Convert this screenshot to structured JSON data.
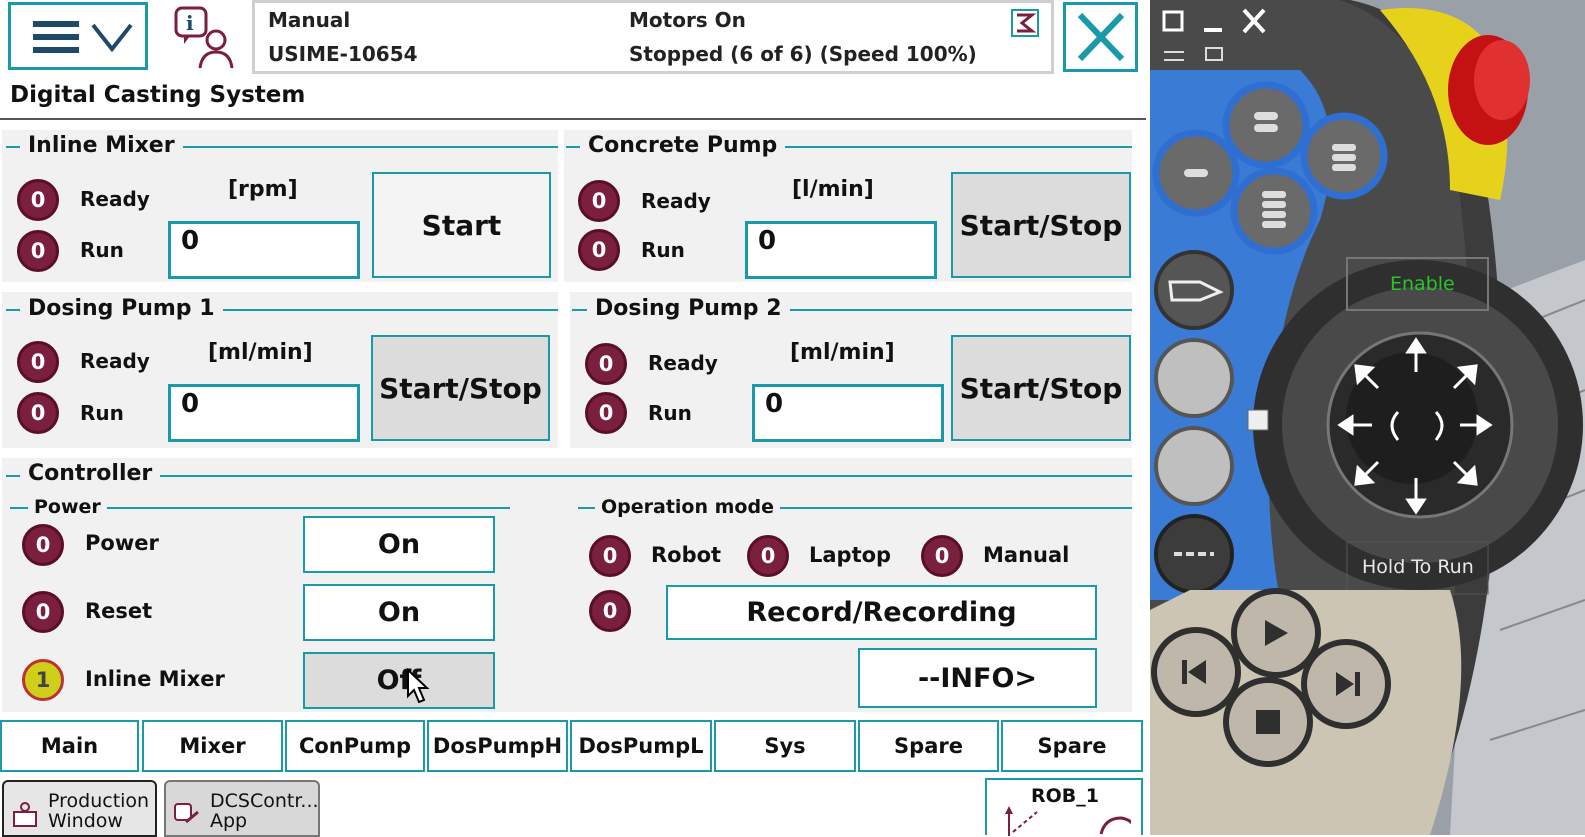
{
  "header": {
    "mode": "Manual",
    "system_id": "USIME-10654",
    "motors": "Motors On",
    "state": "Stopped (6 of 6) (Speed 100%)"
  },
  "app_title": "Digital Casting System",
  "inline_mixer": {
    "title": "Inline Mixer",
    "led_ready": "0",
    "ready": "Ready",
    "led_run": "0",
    "run": "Run",
    "unit": "[rpm]",
    "value": "0",
    "button": "Start"
  },
  "concrete_pump": {
    "title": "Concrete Pump",
    "led_ready": "0",
    "ready": "Ready",
    "led_run": "0",
    "run": "Run",
    "unit": "[l/min]",
    "value": "0",
    "button": "Start/Stop"
  },
  "dosing_pump_1": {
    "title": "Dosing Pump 1",
    "led_ready": "0",
    "ready": "Ready",
    "led_run": "0",
    "run": "Run",
    "unit": "[ml/min]",
    "value": "0",
    "button": "Start/Stop"
  },
  "dosing_pump_2": {
    "title": "Dosing Pump 2",
    "led_ready": "0",
    "ready": "Ready",
    "led_run": "0",
    "run": "Run",
    "unit": "[ml/min]",
    "value": "0",
    "button": "Start/Stop"
  },
  "controller": {
    "title": "Controller",
    "power_group": "Power",
    "power": {
      "led": "0",
      "label": "Power",
      "button": "On"
    },
    "reset": {
      "led": "0",
      "label": "Reset",
      "button": "On"
    },
    "inline_mixer": {
      "led": "1",
      "label": "Inline Mixer",
      "button": "Off"
    },
    "operation_group": "Operation mode",
    "robot": {
      "led": "0",
      "label": "Robot"
    },
    "laptop": {
      "led": "0",
      "label": "Laptop"
    },
    "manual": {
      "led": "0",
      "label": "Manual"
    },
    "record": {
      "led": "0",
      "button": "Record/Recording"
    },
    "info_button": "--INFO>"
  },
  "tabs": [
    "Main",
    "Mixer",
    "ConPump",
    "DosPumpH",
    "DosPumpL",
    "Sys",
    "Spare",
    "Spare"
  ],
  "taskbar": {
    "production": "Production Window",
    "dcs": "DCSContr... App",
    "rob": "ROB_1"
  },
  "pendant": {
    "enable": "Enable",
    "hold_to_run": "Hold To Run"
  },
  "colors": {
    "accent": "#1a9aa8",
    "led_off": "#7a1f3d",
    "led_on": "#cfcf1a",
    "pendant_blue": "#3a7bd5",
    "estop_red": "#d42020",
    "enable_green": "#29c429"
  }
}
